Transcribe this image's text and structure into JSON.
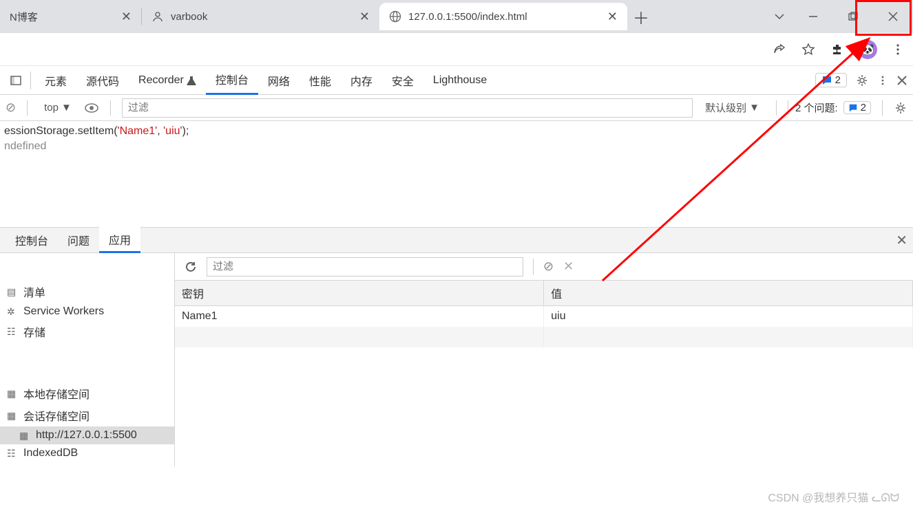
{
  "tabs": {
    "t0": {
      "title": "N博客"
    },
    "t1": {
      "title": "varbook"
    },
    "t2": {
      "title": "127.0.0.1:5500/index.html"
    }
  },
  "devtools": {
    "dock_icon": "dock",
    "tabs": {
      "elements": "元素",
      "sources": "源代码",
      "recorder": "Recorder",
      "console": "控制台",
      "network": "网络",
      "performance": "性能",
      "memory": "内存",
      "security": "安全",
      "lighthouse": "Lighthouse"
    },
    "badge_count": "2"
  },
  "console_bar": {
    "context": "top",
    "filter_placeholder": "过滤",
    "level": "默认级别",
    "issues_label": "2 个问题:",
    "issues_count": "2"
  },
  "console_output": {
    "line1_pre": "essionStorage.setItem(",
    "line1_a": "'Name1'",
    "line1_sep": ", ",
    "line1_b": "'uiu'",
    "line1_post": ");",
    "line2": "ndefined"
  },
  "drawer": {
    "tabs": {
      "console": "控制台",
      "issues": "问题",
      "application": "应用"
    }
  },
  "app_sidebar": {
    "manifest": "清单",
    "sw": "Service Workers",
    "storage": "存储",
    "local": "本地存储空间",
    "session": "会话存储空间",
    "session_child": "http://127.0.0.1:5500",
    "indexeddb": "IndexedDB"
  },
  "storage_toolbar": {
    "filter_placeholder": "过滤"
  },
  "storage_table": {
    "key_header": "密钥",
    "value_header": "值",
    "rows": [
      {
        "key": "Name1",
        "value": "uiu"
      }
    ]
  },
  "watermark": "CSDN @我想养只猫 ᓚᘏᗢ"
}
